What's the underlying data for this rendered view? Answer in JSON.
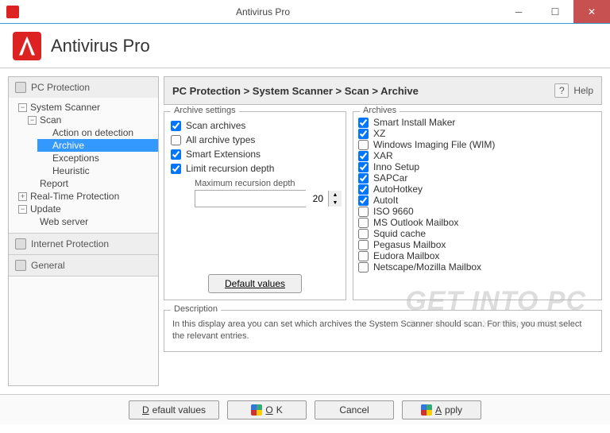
{
  "titlebar": {
    "title": "Antivirus Pro"
  },
  "header": {
    "brand": "Antivirus Pro"
  },
  "breadcrumb": "PC Protection > System Scanner > Scan > Archive",
  "help": "Help",
  "sidebar": {
    "sections": [
      {
        "label": "PC Protection"
      },
      {
        "label": "Internet Protection"
      },
      {
        "label": "General"
      }
    ],
    "tree": {
      "system_scanner": "System Scanner",
      "scan": "Scan",
      "action": "Action on detection",
      "archive": "Archive",
      "exceptions": "Exceptions",
      "heuristic": "Heuristic",
      "report": "Report",
      "realtime": "Real-Time Protection",
      "update": "Update",
      "webserver": "Web server"
    }
  },
  "archive_settings": {
    "legend": "Archive settings",
    "scan_archives": "Scan archives",
    "all_types": "All archive types",
    "smart_ext": "Smart Extensions",
    "limit_recursion": "Limit recursion depth",
    "max_recursion_label": "Maximum recursion depth",
    "max_recursion_value": "20",
    "default_btn": "Default values"
  },
  "archives": {
    "legend": "Archives",
    "items": [
      {
        "label": "Smart Install Maker",
        "checked": true
      },
      {
        "label": "XZ",
        "checked": true
      },
      {
        "label": "Windows Imaging File (WIM)",
        "checked": false
      },
      {
        "label": "XAR",
        "checked": true
      },
      {
        "label": "Inno Setup",
        "checked": true
      },
      {
        "label": "SAPCar",
        "checked": true
      },
      {
        "label": "AutoHotkey",
        "checked": true
      },
      {
        "label": "AutoIt",
        "checked": true
      },
      {
        "label": "ISO 9660",
        "checked": false
      },
      {
        "label": "MS Outlook Mailbox",
        "checked": false
      },
      {
        "label": "Squid cache",
        "checked": false
      },
      {
        "label": "Pegasus Mailbox",
        "checked": false
      },
      {
        "label": "Eudora Mailbox",
        "checked": false
      },
      {
        "label": "Netscape/Mozilla Mailbox",
        "checked": false
      }
    ]
  },
  "description": {
    "legend": "Description",
    "text": "In this display area you can set which archives the System Scanner should scan. For this, you must select the relevant entries."
  },
  "footer": {
    "default": "Default values",
    "ok": "OK",
    "cancel": "Cancel",
    "apply": "Apply"
  },
  "watermark": {
    "main": "GET INTO PC",
    "sub": "Download Free Your Desired App"
  }
}
